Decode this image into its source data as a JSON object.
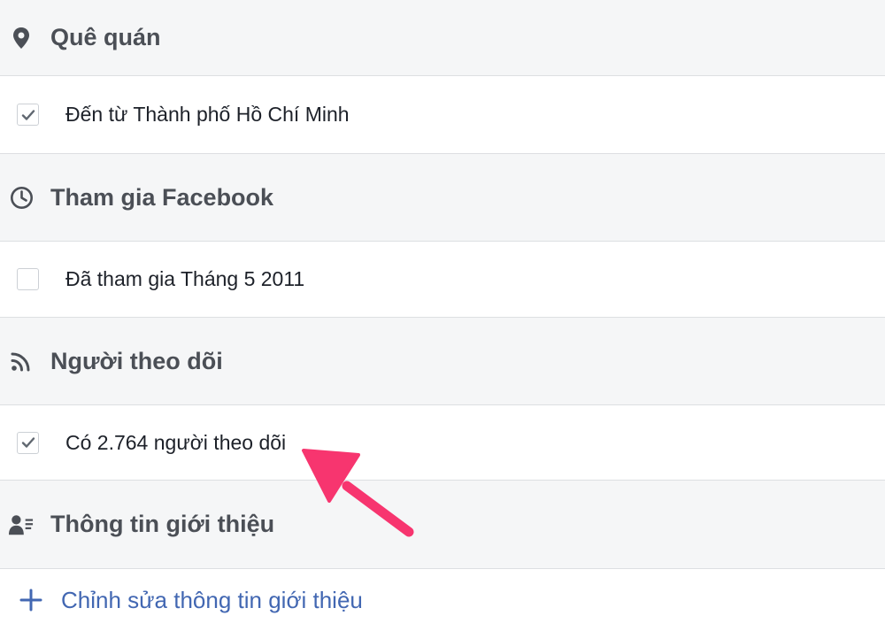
{
  "sections": {
    "hometown": {
      "title": "Quê quán",
      "icon": "location-pin-icon"
    },
    "hometown_item": {
      "text": "Đến từ Thành phố Hồ Chí Minh",
      "checked": true
    },
    "joined": {
      "title": "Tham gia Facebook",
      "icon": "clock-icon"
    },
    "joined_item": {
      "text": "Đã tham gia Tháng 5 2011",
      "checked": false
    },
    "followers": {
      "title": "Người theo dõi",
      "icon": "rss-feed-icon"
    },
    "followers_item": {
      "text": "Có 2.764 người theo dõi",
      "checked": true
    },
    "intro": {
      "title": "Thông tin giới thiệu",
      "icon": "profile-card-icon"
    },
    "edit_intro": {
      "label": "Chỉnh sửa thông tin giới thiệu",
      "icon": "plus-icon"
    }
  },
  "colors": {
    "header_bg": "#f5f6f7",
    "divider": "#dddfe2",
    "heading_text": "#4b4f56",
    "body_text": "#1d2129",
    "link": "#4267b2",
    "annotation_arrow": "#f7356f"
  }
}
